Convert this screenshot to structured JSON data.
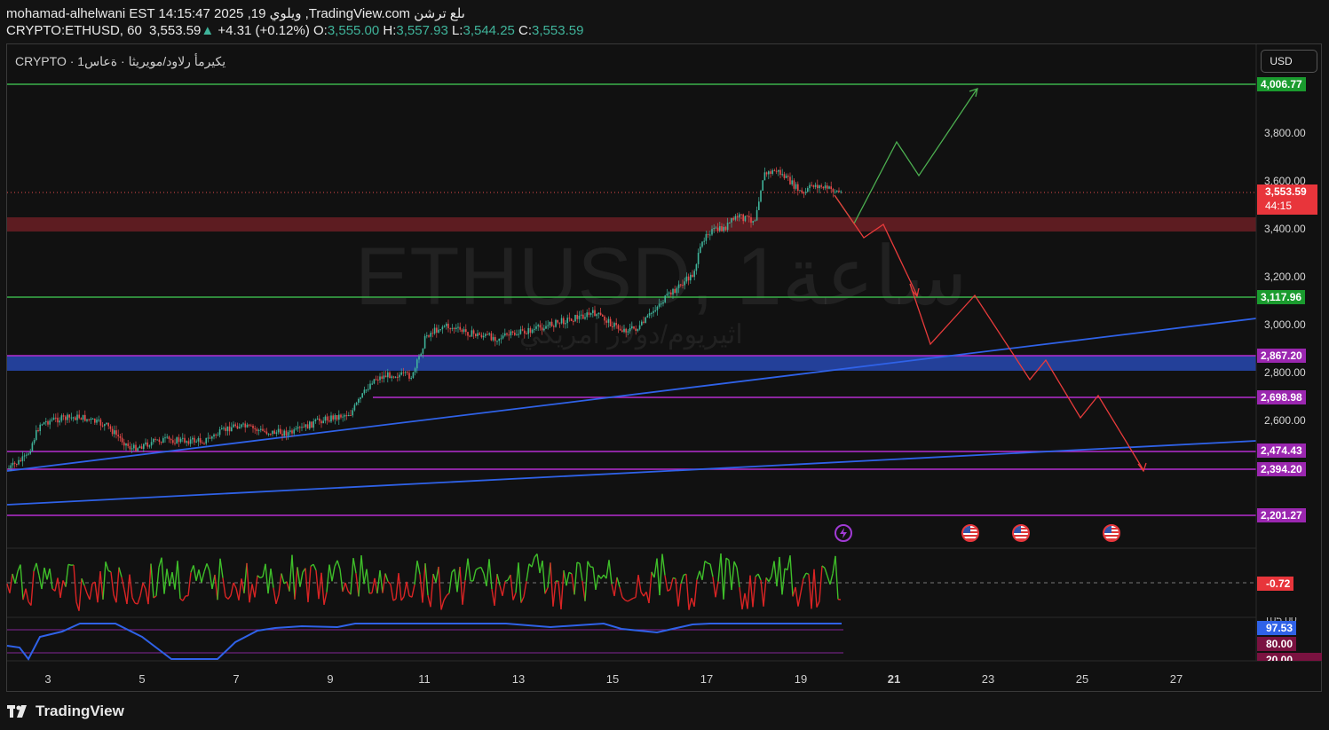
{
  "header": {
    "line1": "mohamad-alhelwani EST 14:15:47 2025 ,19 ويلوي ,TradingView.com ىلع ترشن",
    "symbol": "CRYPTO:ETHUSD, 60",
    "last": "3,553.59",
    "change": "+4.31 (+0.12%)",
    "o_label": "O:",
    "o": "3,555.00",
    "h_label": "H:",
    "h": "3,557.93",
    "l_label": "L:",
    "l": "3,544.25",
    "c_label": "C:",
    "c": "3,553.59"
  },
  "legend": {
    "title": "CRYPTO · يكيرمأ رلاود/مويريثا · ةعاس1"
  },
  "watermark": {
    "main": "ETHUSD, 1ساعة",
    "sub": "اثيريوم/دولار امريكي"
  },
  "currency_button": "USD",
  "price_axis": {
    "ticks": [
      "3,800.00",
      "3,600.00",
      "3,400.00",
      "3,200.00",
      "3,000.00",
      "2,800.00",
      "2,600.00"
    ],
    "tags": [
      {
        "text": "4,006.77",
        "color": "#1a9b2e"
      },
      {
        "text": "3,117.96",
        "color": "#1a9b2e"
      },
      {
        "text": "2,867.20",
        "color": "#9b27b0"
      },
      {
        "text": "2,698.98",
        "color": "#9b27b0"
      },
      {
        "text": "2,474.43",
        "color": "#9b27b0"
      },
      {
        "text": "2,394.20",
        "color": "#9b27b0"
      },
      {
        "text": "2,201.27",
        "color": "#9b27b0"
      }
    ],
    "current_price": "3,553.59",
    "countdown": "44:15"
  },
  "osc_axis": {
    "value": "-0.72",
    "rsi_partial": "105.00",
    "rsi_value": "97.53",
    "rsi_upper": "80.00",
    "rsi_lower": "20.00"
  },
  "time_axis": {
    "labels": [
      "3",
      "5",
      "7",
      "9",
      "11",
      "13",
      "15",
      "17",
      "19",
      "21",
      "23",
      "25",
      "27"
    ]
  },
  "footer": {
    "brand": "TradingView"
  },
  "colors": {
    "up": "#3fb39a",
    "green_line": "#3ab34a",
    "purple_line": "#b52ed0",
    "blue_line": "#2f62e8",
    "red_path": "#e83b3b",
    "green_path": "#4caf50"
  }
}
